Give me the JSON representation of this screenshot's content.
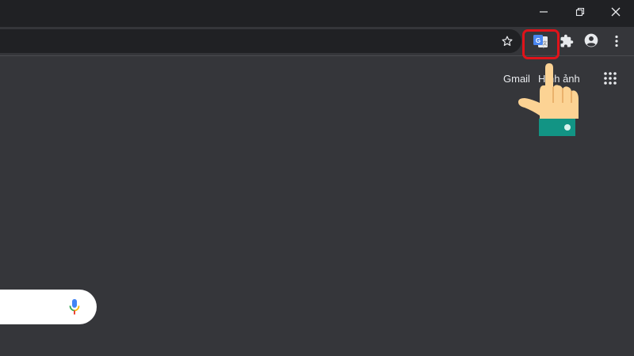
{
  "window_controls": {
    "minimize_icon": "minimize-icon",
    "restore_icon": "restore-icon",
    "close_icon": "close-icon"
  },
  "toolbar": {
    "bookmark_icon": "star-outline-icon",
    "translate_extension_icon": "google-translate-icon",
    "extensions_icon": "puzzle-icon",
    "profile_icon": "account-circle-icon",
    "menu_icon": "three-dots-vertical-icon"
  },
  "header_links": {
    "gmail": "Gmail",
    "images": "Hình ảnh",
    "apps_icon": "apps-grid-icon"
  },
  "search": {
    "mic_icon": "microphone-icon"
  },
  "colors": {
    "titlebar_bg": "#202124",
    "toolbar_bg": "#35363a",
    "page_bg": "#35363a",
    "highlight_border": "#e0131a",
    "hand_skin": "#fcd394",
    "cuff": "#129484"
  }
}
